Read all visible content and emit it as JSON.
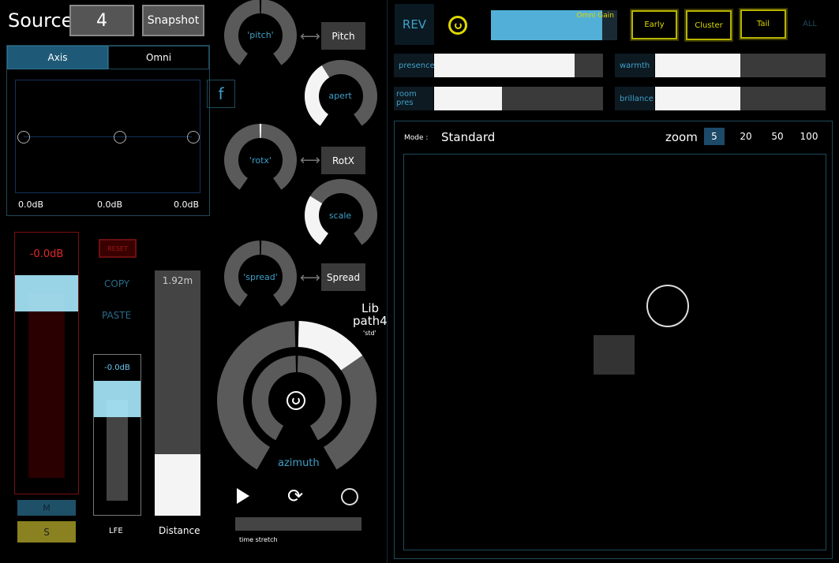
{
  "source": {
    "label": "Source",
    "number": "4",
    "snapshot": "Snapshot"
  },
  "tabs": [
    {
      "label": "Axis",
      "active": true
    },
    {
      "label": "Omni",
      "active": false
    }
  ],
  "f_button": "f",
  "axis_gains": [
    "0.0dB",
    "0.0dB",
    "0.0dB"
  ],
  "main_fader": {
    "value": "-0.0dB",
    "level": 0.85
  },
  "reset": "RESET",
  "copy": "COPY",
  "paste": "PASTE",
  "mute": "M",
  "solo": "S",
  "lfe": {
    "value": "-0.0dB",
    "label": "LFE",
    "level": 0.85
  },
  "distance": {
    "value": "1.92m",
    "label": "Distance",
    "fill": 0.25
  },
  "knobs": {
    "pitch": {
      "label": "'pitch'",
      "value": 0.5,
      "button": "Pitch"
    },
    "apert": {
      "label": "apert",
      "value": 0.39
    },
    "rotx": {
      "label": "'rotx'",
      "value": 0.5,
      "button": "RotX"
    },
    "scale": {
      "label": "scale",
      "value": 0.3
    },
    "spread": {
      "label": "'spread'",
      "value": 0.5,
      "button": "Spread"
    }
  },
  "lib": {
    "line1": "Lib",
    "line2": "path4",
    "preset": "'std'"
  },
  "azimuth": {
    "label": "azimuth",
    "value": 0.15
  },
  "time_stretch": {
    "label": "time stretch",
    "value": 0
  },
  "rev": {
    "label": "REV",
    "omni_gain_label": "Omni Gain",
    "omni_gain": 0.88,
    "buttons": [
      "Early",
      "Cluster",
      "Tail"
    ],
    "all": "ALL"
  },
  "params": [
    {
      "label": "presence",
      "value": 0.83
    },
    {
      "label": "warmth",
      "value": 0.5
    },
    {
      "label": "room pres",
      "value": 0.4
    },
    {
      "label": "brillance",
      "value": 0.5
    }
  ],
  "mode": {
    "label": "Mode :",
    "value": "Standard"
  },
  "zoom": {
    "label": "zoom",
    "options": [
      "5",
      "20",
      "50",
      "100"
    ],
    "selected": "5"
  },
  "colors": {
    "accent": "#3fa0c8",
    "yellow": "#ddd800",
    "red": "#cc2222"
  }
}
